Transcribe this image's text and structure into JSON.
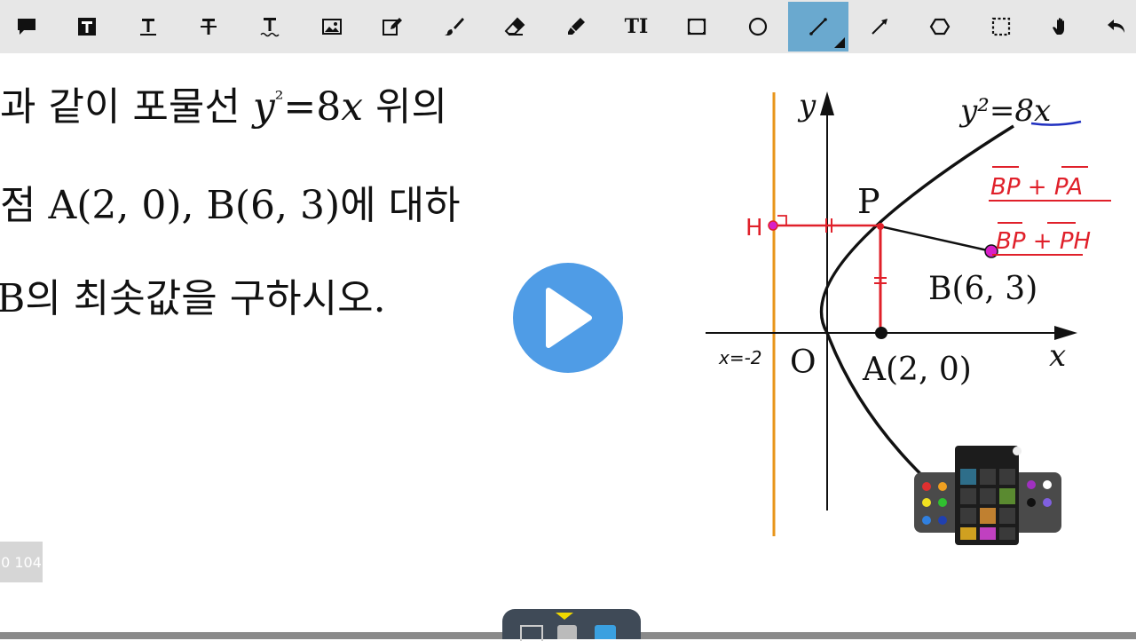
{
  "toolbar": {
    "tools": [
      {
        "name": "speech-bubble",
        "icon": "speech-bubble-icon"
      },
      {
        "name": "text-box",
        "icon": "text-box-icon",
        "label": "T"
      },
      {
        "name": "text",
        "icon": "text-underline-icon",
        "label": "T"
      },
      {
        "name": "strikethrough",
        "icon": "strikethrough-icon",
        "label": "T"
      },
      {
        "name": "wavy-underline",
        "icon": "wavy-underline-icon",
        "label": "T"
      },
      {
        "name": "image",
        "icon": "image-icon"
      },
      {
        "name": "edit",
        "icon": "edit-icon"
      },
      {
        "name": "brush",
        "icon": "brush-icon"
      },
      {
        "name": "eraser",
        "icon": "eraser-icon"
      },
      {
        "name": "highlighter",
        "icon": "highlighter-icon"
      },
      {
        "name": "text-insert",
        "icon": "text-cursor-icon",
        "label": "TI"
      },
      {
        "name": "rectangle",
        "icon": "rectangle-icon"
      },
      {
        "name": "ellipse",
        "icon": "circle-icon"
      },
      {
        "name": "line",
        "icon": "line-icon",
        "active": true
      },
      {
        "name": "arrow",
        "icon": "arrow-icon"
      },
      {
        "name": "polygon",
        "icon": "hexagon-icon"
      },
      {
        "name": "select",
        "icon": "selection-icon"
      },
      {
        "name": "pan",
        "icon": "hand-icon"
      },
      {
        "name": "undo",
        "icon": "undo-icon"
      }
    ]
  },
  "problem": {
    "line1_a": "과 같이 포물선 ",
    "line1_b": "y",
    "line1_c": "²",
    "line1_d": "=8",
    "line1_e": "x",
    "line1_f": " 위의",
    "line2": "점 A(2, 0), B(6, 3)에 대하",
    "line3": "B의 최솟값을 구하시오."
  },
  "page_badge": "0 104",
  "graph": {
    "y_axis": "y",
    "x_axis": "x",
    "origin": "O",
    "equation": "y²=8x",
    "point_p": "P",
    "point_b": "B(6, 3)",
    "point_a": "A(2, 0)",
    "directrix": "x=-2",
    "point_h": "H",
    "note1": "BP + PA",
    "note2": "BP + PH"
  },
  "colors": {
    "play": "#4f9ce6",
    "red_ink": "#e0202a",
    "directrix": "#e8951a",
    "active_tool": "#6aa9cf",
    "magenta": "#d81fc8"
  }
}
